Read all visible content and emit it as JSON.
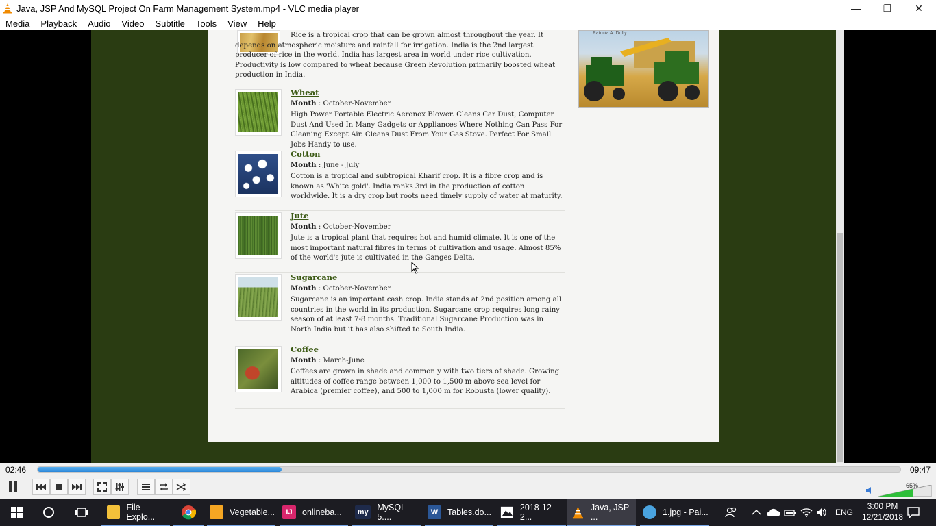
{
  "window": {
    "title": "Java, JSP And MySQL Project On Farm Management System.mp4 - VLC media player",
    "minimize": "—",
    "maximize": "❐",
    "close": "✕"
  },
  "menu": [
    "Media",
    "Playback",
    "Audio",
    "Video",
    "Subtitle",
    "Tools",
    "View",
    "Help"
  ],
  "content": {
    "intro": "Rice is a tropical crop that can be grown almost throughout the year. It depends on atmospheric moisture and rainfall for irrigation. India is the 2nd largest producer of rice in the world. India has largest area in world under rice cultivation. Productivity is low compared to wheat because Green Revolution primarily boosted wheat production in India.",
    "month_label": "Month",
    "crops": [
      {
        "name": "Wheat",
        "month": " : October-November",
        "desc": "High Power Portable Electric Aeronox Blower. Cleans Car Dust, Computer Dust And Used In Many Gadgets or Appliances Where Nothing Can Pass For Cleaning Except Air. Cleans Dust From Your Gas Stove. Perfect For Small Jobs Handy to use."
      },
      {
        "name": "Cotton",
        "month": " : June - July",
        "desc": "Cotton is a tropical and subtropical Kharif crop. It is a fibre crop and is known as 'White gold'. India ranks 3rd in the production of cotton worldwide. It is a dry crop but roots need timely supply of water at maturity."
      },
      {
        "name": "Jute",
        "month": " : October-November",
        "desc": "Jute is a tropical plant that requires hot and humid climate. It is one of the most important natural fibres in terms of cultivation and usage. Almost 85% of the world's jute is cultivated in the Ganges Delta."
      },
      {
        "name": "Sugarcane",
        "month": " : October-November",
        "desc": "Sugarcane is an important cash crop. India stands at 2nd position among all countries in the world in its production. Sugarcane crop requires long rainy season of at least 7-8 months. Traditional Sugarcane Production was in North India but it has also shifted to South India."
      },
      {
        "name": "Coffee",
        "month": " : March-June",
        "desc": "Coffees are grown in shade and commonly with two tiers of shade. Growing altitudes of coffee range between 1,000 to 1,500 m above sea level for Arabica (premier coffee), and 500 to 1,000 m for Robusta (lower quality)."
      }
    ],
    "ad_author": "Patricia A. Duffy"
  },
  "player": {
    "elapsed": "02:46",
    "total": "09:47",
    "progress": 0.283,
    "volume_label": "65%",
    "volume": 0.65
  },
  "taskbar": {
    "items": [
      {
        "label": "File Explo...",
        "icon": "folder-icon",
        "color": "#f3c13a"
      },
      {
        "label": "",
        "icon": "chrome-icon",
        "color": "#db4437"
      },
      {
        "label": "Vegetable...",
        "icon": "app-icon",
        "color": "#f5a623"
      },
      {
        "label": "onlineba...",
        "icon": "intellij-icon",
        "color": "#d8266c"
      },
      {
        "label": "MySQL 5....",
        "icon": "mysql-icon",
        "color": "#1e2a4a"
      },
      {
        "label": "Tables.do...",
        "icon": "word-icon",
        "color": "#2b5797"
      },
      {
        "label": "2018-12-2...",
        "icon": "photos-icon",
        "color": "#ffffff"
      },
      {
        "label": "Java, JSP ...",
        "icon": "vlc-icon",
        "color": "#f08a00"
      },
      {
        "label": "1.jpg - Pai...",
        "icon": "paint-icon",
        "color": "#4aa3df"
      }
    ],
    "language": "ENG",
    "time": "3:00 PM",
    "date": "12/21/2018"
  }
}
